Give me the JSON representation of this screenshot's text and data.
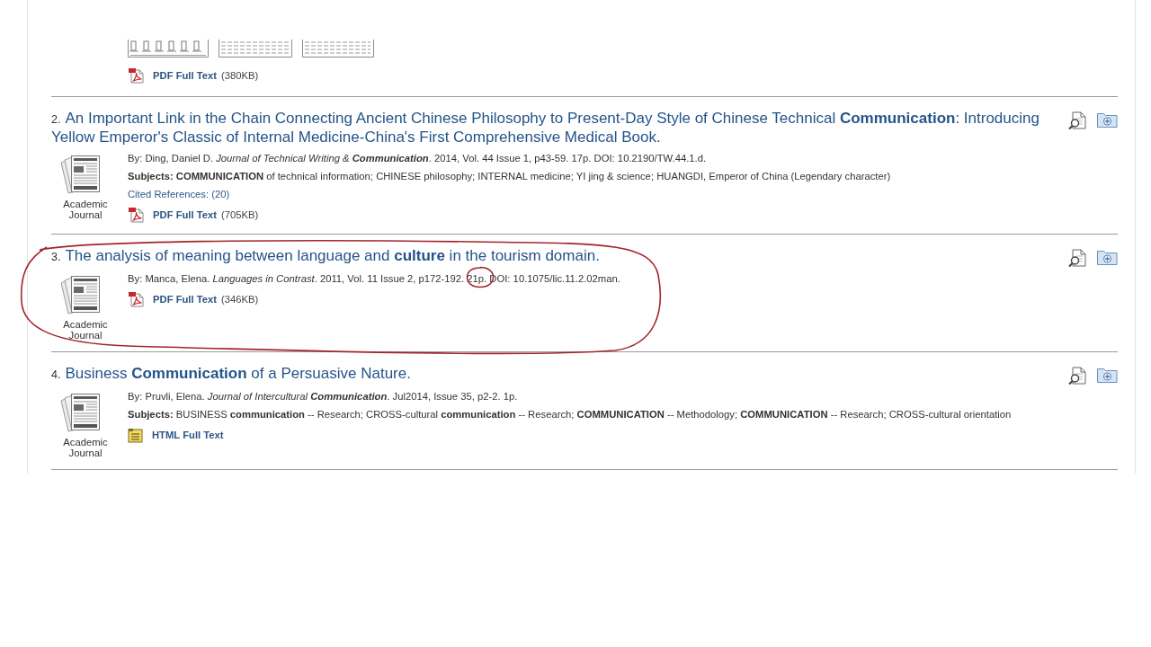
{
  "partial_result": {
    "previews": [
      {
        "kind": "table"
      },
      {
        "kind": "text"
      },
      {
        "kind": "text"
      }
    ],
    "links": [
      {
        "kind": "pdf",
        "label": "PDF Full Text",
        "size": "(380KB)"
      }
    ]
  },
  "results": [
    {
      "number": "2.",
      "title": "An Important Link in the Chain Connecting Ancient Chinese Philosophy to Present-Day Style of Chinese Technical **Communication**: Introducing Yellow Emperor's Classic of Internal Medicine-China's First Comprehensive Medical Book.",
      "type_label": "Academic Journal",
      "circled": false,
      "details": [
        {
          "kind": "text",
          "text": "By: Ding, Daniel D. *Journal of Technical Writing &* **Communication**. 2014, Vol. 44 Issue 1, p43-59. 17p. DOI: 10.2190/TW.44.1.d."
        },
        {
          "kind": "text",
          "text": "**Subjects:** **COMMUNICATION** of technical information; CHINESE philosophy; INTERNAL medicine; YI jing & science; HUANGDI, Emperor of China (Legendary character)"
        },
        {
          "kind": "link",
          "text": "Cited References: (20)"
        }
      ],
      "links": [
        {
          "kind": "pdf",
          "label": "PDF Full Text",
          "size": "(705KB)"
        }
      ]
    },
    {
      "number": "3.",
      "title": "The analysis of meaning between language and **culture** in the tourism domain.",
      "type_label": "Academic Journal",
      "circled": true,
      "details": [
        {
          "kind": "text",
          "text": "By: Manca, Elena. *Languages in Contrast*. 2011, Vol. 11 Issue 2, p172-192. 21p. DOI: 10.1075/lic.11.2.02man."
        }
      ],
      "links": [
        {
          "kind": "pdf",
          "label": "PDF Full Text",
          "size": "(346KB)"
        }
      ]
    },
    {
      "number": "4.",
      "title": "Business **Communication** of a Persuasive Nature.",
      "type_label": "Academic Journal",
      "circled": false,
      "details": [
        {
          "kind": "text",
          "text": "By: Pruvli, Elena. *Journal of Intercultural* **Communication**. Jul2014, Issue 35, p2-2. 1p."
        },
        {
          "kind": "text",
          "text": "**Subjects:** BUSINESS **communication** -- Research; CROSS-cultural **communication** -- Research; **COMMUNICATION** -- Methodology; **COMMUNICATION** -- Research; CROSS-cultural orientation"
        }
      ],
      "links": [
        {
          "kind": "html",
          "label": "HTML Full Text"
        }
      ]
    }
  ]
}
